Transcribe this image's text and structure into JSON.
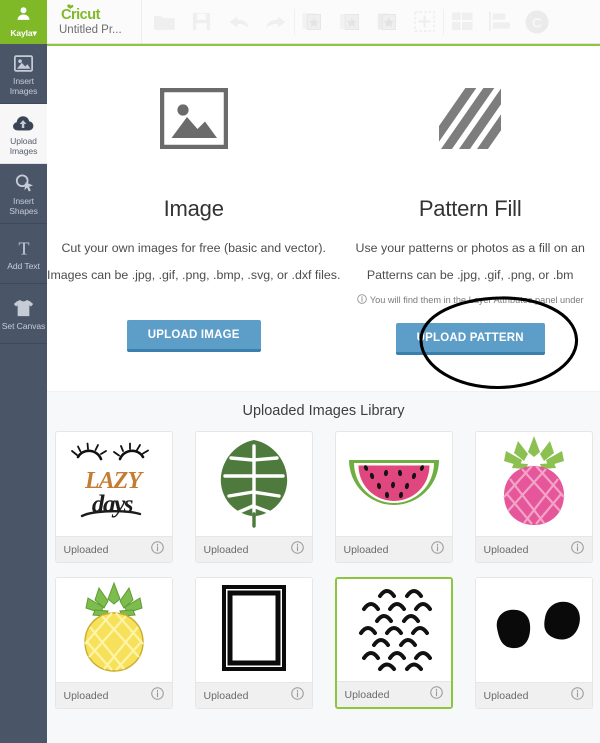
{
  "header": {
    "user": {
      "name": "Kayla",
      "caret": "▾",
      "icon": "user-avatar-icon"
    },
    "brand": "Cricut",
    "project_title": "Untitled Pr...",
    "tools": [
      {
        "name": "open-folder-icon",
        "label": "Open"
      },
      {
        "name": "save-icon",
        "label": "Save"
      },
      {
        "name": "undo-icon",
        "label": "Undo"
      },
      {
        "name": "redo-icon",
        "label": "Redo"
      },
      {
        "name": "duplicate-layers-icon",
        "label": "Duplicate"
      },
      {
        "name": "group-layers-icon",
        "label": "Group"
      },
      {
        "name": "flatten-layers-icon",
        "label": "Flatten"
      },
      {
        "name": "select-all-icon",
        "label": "Select All"
      },
      {
        "name": "arrange-grid-icon",
        "label": "Arrange"
      },
      {
        "name": "align-icon",
        "label": "Align"
      },
      {
        "name": "cricut-cut-icon",
        "label": "Make It"
      }
    ]
  },
  "sidebar": {
    "items": [
      {
        "label1": "Insert",
        "label2": "Images",
        "icon": "insert-images-icon",
        "active": false
      },
      {
        "label1": "Upload",
        "label2": "Images",
        "icon": "upload-cloud-icon",
        "active": true
      },
      {
        "label1": "Insert",
        "label2": "Shapes",
        "icon": "insert-shapes-icon",
        "active": false
      },
      {
        "label1": "Add Text",
        "label2": "",
        "icon": "add-text-icon",
        "active": false
      },
      {
        "label1": "Set Canvas",
        "label2": "",
        "icon": "set-canvas-shirt-icon",
        "active": false
      }
    ]
  },
  "upload_options": [
    {
      "icon": "image-placeholder-icon",
      "title": "Image",
      "desc1": "Cut your own images for free (basic and vector).",
      "desc2": "Images can be .jpg, .gif, .png, .bmp, .svg, or .dxf files.",
      "note": "",
      "button": "UPLOAD IMAGE",
      "button_name": "upload-image-button"
    },
    {
      "icon": "pattern-fill-icon",
      "title": "Pattern Fill",
      "desc1": "Use your patterns or photos as a fill on an",
      "desc2": "Patterns can be .jpg, .gif, .png, or .bm",
      "note": "You will find them in the Layer Attributes panel under",
      "button": "UPLOAD PATTERN",
      "button_name": "upload-pattern-button"
    }
  ],
  "library": {
    "title": "Uploaded Images Library",
    "cards": [
      {
        "art": "lazy-days-lettering",
        "status": "Uploaded",
        "selected": false
      },
      {
        "art": "monstera-leaf",
        "status": "Uploaded",
        "selected": false
      },
      {
        "art": "watermelon-slice",
        "status": "Uploaded",
        "selected": false
      },
      {
        "art": "pink-pineapple",
        "status": "Uploaded",
        "selected": false
      },
      {
        "art": "yellow-pineapple",
        "status": "Uploaded",
        "selected": false
      },
      {
        "art": "black-frame",
        "status": "Uploaded",
        "selected": false
      },
      {
        "art": "chevron-arc-pattern",
        "status": "Uploaded",
        "selected": true
      },
      {
        "art": "black-blobs",
        "status": "Uploaded",
        "selected": false
      }
    ]
  },
  "colors": {
    "brand_green": "#7fb927",
    "accent_green": "#8cc63e",
    "button_blue": "#5d9ec9",
    "sidebar_navy": "#4a5568"
  }
}
